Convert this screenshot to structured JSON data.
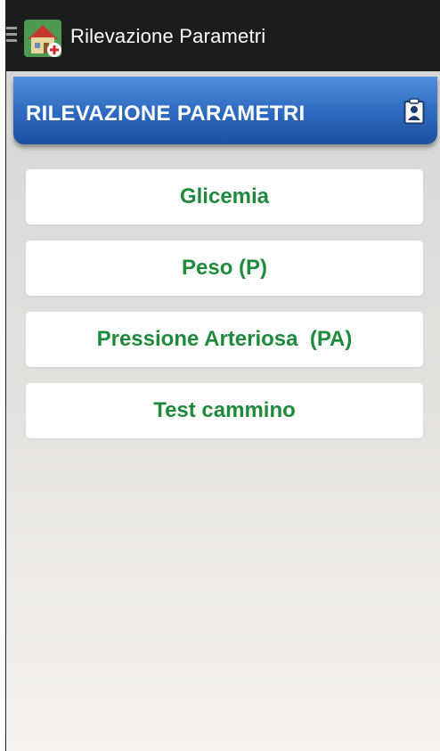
{
  "app_bar": {
    "title": "Rilevazione Parametri",
    "icon": "house-medical-icon"
  },
  "header": {
    "title": "RILEVAZIONE PARAMETRI",
    "icon": "clipboard-user-icon"
  },
  "menu": {
    "items": [
      {
        "label": "Glicemia"
      },
      {
        "label": "Peso (P)"
      },
      {
        "label": "Pressione Arteriosa  (PA)"
      },
      {
        "label": "Test cammino"
      }
    ]
  },
  "colors": {
    "app_bar_bg": "#1c1c1c",
    "header_blue": "#2f6cc2",
    "button_text_green": "#1f8a3c",
    "button_bg": "#ffffff"
  }
}
